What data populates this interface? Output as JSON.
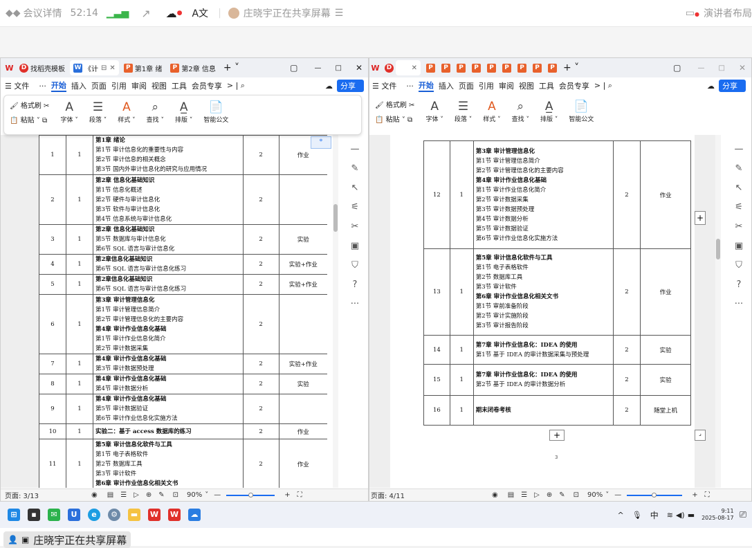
{
  "meeting": {
    "title": "会议详情",
    "timer": "52:14",
    "sharer": "庄晓宇正在共享屏幕",
    "presenter": "演讲者布局"
  },
  "left": {
    "tabs": [
      "找稻壳模板",
      "《计",
      "第1章 绪",
      "第2章 信息"
    ],
    "menu": [
      "文件",
      "···",
      "开始",
      "插入",
      "页面",
      "引用",
      "审阅",
      "视图",
      "工具",
      "会员专享"
    ],
    "share": "分享",
    "ribbon": {
      "format": "格式刷",
      "paste": "粘贴",
      "font": "字体",
      "para": "段落",
      "style": "样式",
      "find": "查找",
      "layout": "排版",
      "smart": "智能公文"
    },
    "rows": [
      {
        "n": "1",
        "w": "1",
        "lines": [
          [
            "第1章 绪论",
            1
          ],
          [
            "第1节 审计信息化的重要性与内容",
            0
          ],
          [
            "第2节 审计信息的相关概念",
            0
          ],
          [
            "第3节 国内外审计信息化的研究与应用情况",
            0
          ]
        ],
        "h": "2",
        "type": "作业",
        "ht": 57
      },
      {
        "n": "2",
        "w": "1",
        "lines": [
          [
            "第2章 信息化基础知识",
            1
          ],
          [
            "第1节 信息化概述",
            0
          ],
          [
            "第2节 硬件与审计信息化",
            0
          ],
          [
            "第3节 软件与审计信息化",
            0
          ],
          [
            "第4节 信息系统与审计信息化",
            0
          ]
        ],
        "h": "2",
        "type": "",
        "ht": 72
      },
      {
        "n": "3",
        "w": "1",
        "lines": [
          [
            "第2章 信息化基础知识",
            1
          ],
          [
            "第5节 数据库与审计信息化",
            0
          ],
          [
            "第6节 SQL 语言与审计信息化",
            0
          ]
        ],
        "h": "2",
        "type": "实验",
        "ht": 43
      },
      {
        "n": "4",
        "w": "1",
        "lines": [
          [
            "第2章信息化基础知识",
            1
          ],
          [
            "第6节 SQL 语言与审计信息化练习",
            0
          ]
        ],
        "h": "2",
        "type": "实验+作业",
        "ht": 28
      },
      {
        "n": "5",
        "w": "1",
        "lines": [
          [
            "第2章信息化基础知识",
            1
          ],
          [
            "第6节 SQL 语言与审计信息化练习",
            0
          ]
        ],
        "h": "2",
        "type": "实验+作业",
        "ht": 28
      },
      {
        "n": "6",
        "w": "1",
        "lines": [
          [
            "第3章 审计管理信息化",
            1
          ],
          [
            "第1节 审计管理信息简介",
            0
          ],
          [
            "第2节 审计管理信息化的主要内容",
            0
          ],
          [
            "第4章 审计作业信息化基础",
            1
          ],
          [
            "第1节 审计作业信息化简介",
            0
          ],
          [
            "第2节 审计数据采集",
            0
          ]
        ],
        "h": "2",
        "type": "",
        "ht": 86
      },
      {
        "n": "7",
        "w": "1",
        "lines": [
          [
            "第4章 审计作业信息化基础",
            1
          ],
          [
            "第3节 审计数据预处理",
            0
          ]
        ],
        "h": "2",
        "type": "实验+作业",
        "ht": 28
      },
      {
        "n": "8",
        "w": "1",
        "lines": [
          [
            "第4章 审计作业信息化基础",
            1
          ],
          [
            "第4节 审计数据分析",
            0
          ]
        ],
        "h": "2",
        "type": "实验",
        "ht": 29
      },
      {
        "n": "9",
        "w": "1",
        "lines": [
          [
            "第4章 审计作业信息化基础",
            1
          ],
          [
            "第5节 审计数据验证",
            0
          ],
          [
            "第6节 审计作业信息化实施方法",
            0
          ]
        ],
        "h": "2",
        "type": "",
        "ht": 43
      },
      {
        "n": "10",
        "w": "1",
        "lines": [
          [
            "实验二：基于 access 数据库的练习",
            1
          ]
        ],
        "h": "2",
        "type": "作业",
        "ht": 22
      },
      {
        "n": "11",
        "w": "1",
        "lines": [
          [
            "第5章 审计信息化软件与工具",
            1
          ],
          [
            "第1节 电子表格软件",
            0
          ],
          [
            "第2节 数据库工具",
            0
          ],
          [
            "第3节 审计软件",
            0
          ],
          [
            "第6章 审计作业信息化相关文书",
            1
          ]
        ],
        "h": "2",
        "type": "作业",
        "ht": 72
      }
    ],
    "page": "页面: 3/13",
    "zoom": "90%"
  },
  "right": {
    "menu": [
      "文件",
      "···",
      "开始",
      "插入",
      "页面",
      "引用",
      "审阅",
      "视图",
      "工具",
      "会员专享"
    ],
    "share": "分享",
    "ribbon": {
      "format": "格式刷",
      "paste": "粘贴",
      "font": "字体",
      "para": "段落",
      "style": "样式",
      "find": "查找",
      "layout": "排版",
      "smart": "智能公文"
    },
    "rows": [
      {
        "n": "12",
        "w": "1",
        "lines": [
          [
            "第3章 审计管理信息化",
            1
          ],
          [
            "第1节 审计管理信息简介",
            0
          ],
          [
            "第2节 审计管理信息化的主要内容",
            0
          ],
          [
            "第4章 审计作业信息化基础",
            1
          ],
          [
            "第1节 审计作业信息化简介",
            0
          ],
          [
            "第2节 审计数据采集",
            0
          ],
          [
            "第3节 审计数据预处理",
            0
          ],
          [
            "第4节 审计数据分析",
            0
          ],
          [
            "第5节 审计数据验证",
            0
          ],
          [
            "第6节 审计作业信息化实施方法",
            0
          ]
        ],
        "h": "2",
        "type": "作业",
        "ht": 156
      },
      {
        "n": "13",
        "w": "1",
        "lines": [
          [
            "第5章 审计信息化软件与工具",
            1
          ],
          [
            "第1节 电子表格软件",
            0
          ],
          [
            "第2节 数据库工具",
            0
          ],
          [
            "第3节 审计软件",
            0
          ],
          [
            "第6章 审计作业信息化相关文书",
            1
          ],
          [
            "第1节 审前准备阶段",
            0
          ],
          [
            "第2节 审计实施阶段",
            0
          ],
          [
            "第3节 审计报告阶段",
            0
          ]
        ],
        "h": "2",
        "type": "作业",
        "ht": 125
      },
      {
        "n": "14",
        "w": "1",
        "lines": [
          [
            "第7章 审计作业信息化：IDEA 的使用",
            1
          ],
          [
            "第1节 基于 IDEA 的审计数据采集与预处理",
            0
          ]
        ],
        "h": "2",
        "type": "实验",
        "ht": 42
      },
      {
        "n": "15",
        "w": "1",
        "lines": [
          [
            "第7章 审计作业信息化：IDEA 的使用",
            1
          ],
          [
            "第2节 基于 IDEA 的审计数据分析",
            0
          ]
        ],
        "h": "2",
        "type": "实验",
        "ht": 45
      },
      {
        "n": "16",
        "w": "1",
        "lines": [
          [
            "期末闭卷考核",
            1
          ]
        ],
        "h": "2",
        "type": "随堂上机",
        "ht": 43
      }
    ],
    "pageno": "3",
    "page": "页面: 4/11",
    "zoom": "90%"
  },
  "taskbar": {
    "ime": "中",
    "time": "9:11",
    "date": "2025-08-17"
  }
}
